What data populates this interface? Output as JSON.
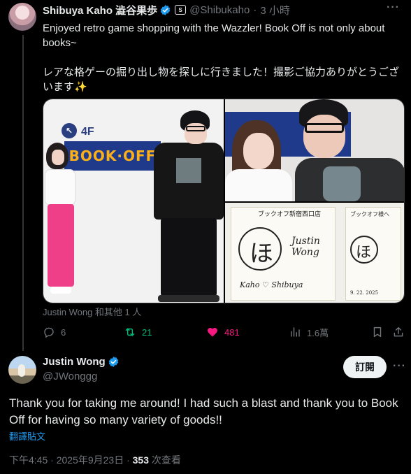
{
  "top_tweet": {
    "author_name": "Shibuya Kaho 澁谷果歩",
    "handle": "@Shibukaho",
    "separator": "·",
    "time": "3 小時",
    "text": "Enjoyed retro game shopping with the Wazzler! Book Off is not only about books~\n\nレアな格ゲーの掘り出し物を探しに行きました！撮影ご協力ありがとうございます✨",
    "tagged": "Justin Wong 和其他 1 人",
    "media_text": {
      "floor": "4F",
      "store_sign": "BOOK·OFF",
      "board_header_a": "ブックオフ新宿西口店",
      "board_header_b": "ブックオフ様へ",
      "board_char": "ほ",
      "signature_a": "Kaho ♡ Shibuya",
      "signature_b": "Justin Wong",
      "board_date": "9. 22. 2025"
    },
    "actions": {
      "replies": "6",
      "retweets": "21",
      "likes": "481",
      "views": "1.6萬"
    }
  },
  "reply": {
    "author_name": "Justin Wong",
    "handle": "@JWonggg",
    "follow_label": "訂閱",
    "text": "Thank you for taking me around! I had such a blast and thank you to Book Off for having so many variety of goods!!",
    "translate_label": "翻譯貼文",
    "timestamp": "下午4:45 · 2025年9月23日 · ",
    "views_count": "353",
    "views_label": " 次查看"
  },
  "colors": {
    "background": "#000000",
    "text_primary": "#e7e9ea",
    "text_secondary": "#71767b",
    "accent_blue": "#1d9bf0",
    "retweet_green": "#00ba7c",
    "like_pink": "#f91880"
  },
  "icons": [
    "verified-badge-icon",
    "sticker-badge-icon",
    "more-icon",
    "reply-icon",
    "retweet-icon",
    "like-icon",
    "views-icon",
    "bookmark-icon",
    "share-icon"
  ]
}
